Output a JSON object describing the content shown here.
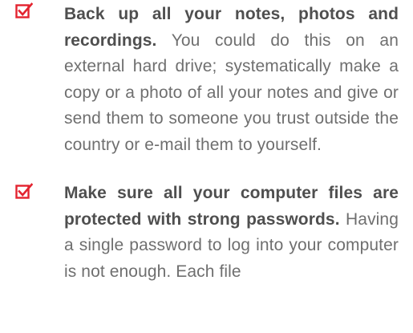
{
  "accent_color": "#e3232f",
  "items": [
    {
      "icon": "checked-box-icon",
      "lead": "Back up all your notes, photos and recordings.",
      "body": " You could do this on an external hard drive; systematically make a copy or a photo of all your notes and give or send them to someone you trust outside the country or e-mail them to yourself."
    },
    {
      "icon": "checked-box-icon",
      "lead": "Make sure all your computer files are protected with strong passwords.",
      "body": " Having a single password to log into your computer is not enough. Each file"
    }
  ]
}
